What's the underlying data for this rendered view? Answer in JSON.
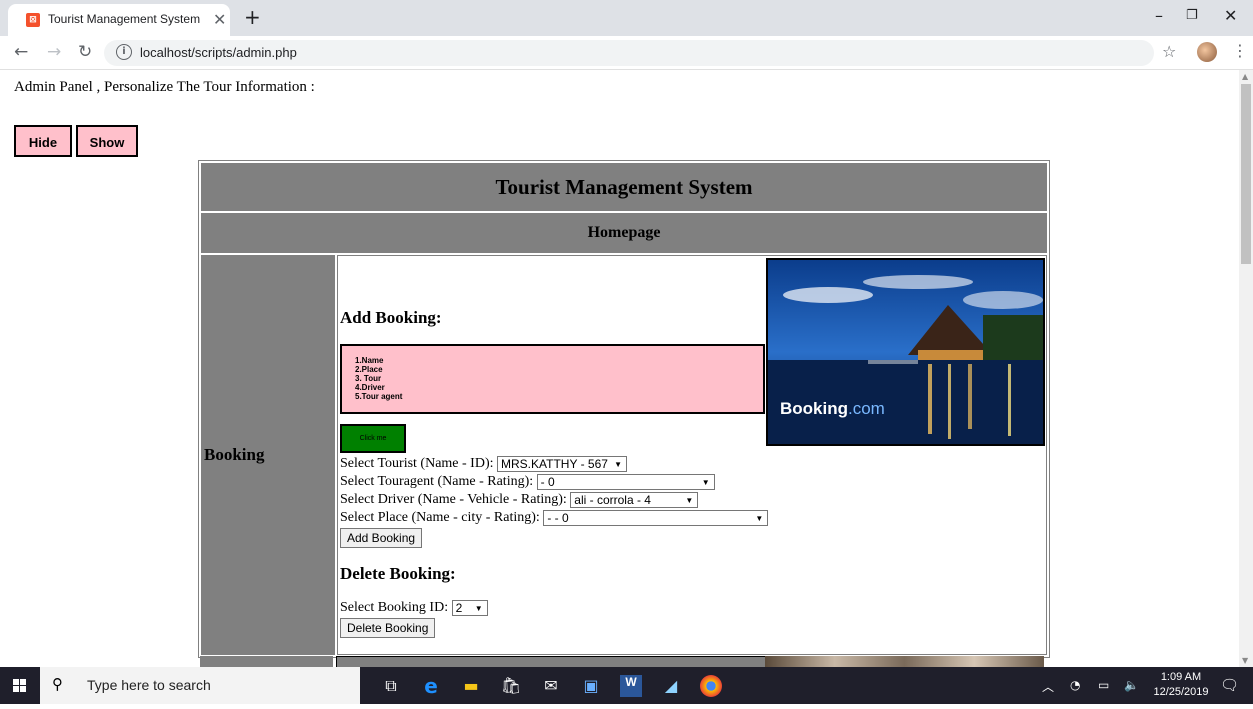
{
  "browser": {
    "tab_title": "Tourist Management System",
    "tab_close": "✕",
    "new_tab": "+",
    "url": "localhost/scripts/admin.php",
    "min": "–",
    "max": "❐",
    "close": "✕"
  },
  "page": {
    "intro": "Admin Panel , Personalize The Tour Information :",
    "hide_label": "Hide",
    "show_label": "Show",
    "title": "Tourist Management System",
    "subtitle": "Homepage",
    "section_label": "Booking",
    "add_title": "Add Booking:",
    "list_items": [
      "1.Name",
      "2.Place",
      "3. Tour",
      "4.Driver",
      "5.Tour agent"
    ],
    "click_label": "Click me",
    "photo_brand": "Booking",
    "photo_brand_suffix": ".com",
    "tourist_label": "Select Tourist (Name - ID):",
    "tourist_value": "MRS.KATTHY - 567",
    "touragent_label": "Select Touragent (Name - Rating):",
    "touragent_value": "- 0",
    "driver_label": "Select Driver (Name - Vehicle - Rating):",
    "driver_value": "ali - corrola - 4",
    "place_label": "Select Place (Name - city - Rating):",
    "place_value": "- - 0",
    "add_button": "Add Booking",
    "delete_title": "Delete Booking:",
    "booking_id_label": "Select Booking ID:",
    "booking_id_value": "2",
    "delete_button": "Delete Booking"
  },
  "taskbar": {
    "search_placeholder": "Type here to search",
    "time": "1:09 AM",
    "date": "12/25/2019"
  }
}
